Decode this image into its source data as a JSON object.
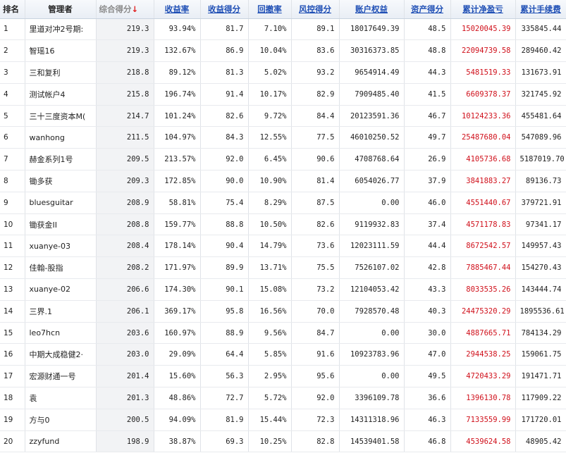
{
  "headers": {
    "rank": "排名",
    "manager": "管理者",
    "composite_score": "综合得分",
    "sort_arrow": "↓",
    "return_rate": "收益率",
    "return_score": "收益得分",
    "drawdown": "回撤率",
    "risk_score": "风控得分",
    "account_equity": "账户权益",
    "asset_score": "资产得分",
    "cum_pnl": "累计净盈亏",
    "cum_fee": "累计手续费"
  },
  "colors": {
    "link": "#1f4fb5",
    "pnl_red": "#d0101b",
    "sort_arrow": "#e02020"
  },
  "rows": [
    {
      "rank": "1",
      "name": "里道对冲2号期:",
      "score": "219.3",
      "ret": "93.94%",
      "ret_score": "81.7",
      "dd": "7.10%",
      "risk": "89.1",
      "equity": "18017649.39",
      "asset": "48.5",
      "pnl": "15020045.39",
      "fee": "335845.44"
    },
    {
      "rank": "2",
      "name": "智瑶16",
      "score": "219.3",
      "ret": "132.67%",
      "ret_score": "86.9",
      "dd": "10.04%",
      "risk": "83.6",
      "equity": "30316373.85",
      "asset": "48.8",
      "pnl": "22094739.58",
      "fee": "289460.42"
    },
    {
      "rank": "3",
      "name": "三和复利",
      "score": "218.8",
      "ret": "89.12%",
      "ret_score": "81.3",
      "dd": "5.02%",
      "risk": "93.2",
      "equity": "9654914.49",
      "asset": "44.3",
      "pnl": "5481519.33",
      "fee": "131673.91"
    },
    {
      "rank": "4",
      "name": "测试帐户4",
      "score": "215.8",
      "ret": "196.74%",
      "ret_score": "91.4",
      "dd": "10.17%",
      "risk": "82.9",
      "equity": "7909485.40",
      "asset": "41.5",
      "pnl": "6609378.37",
      "fee": "321745.92"
    },
    {
      "rank": "5",
      "name": "三十三度资本M(",
      "score": "214.7",
      "ret": "101.24%",
      "ret_score": "82.6",
      "dd": "9.72%",
      "risk": "84.4",
      "equity": "20123591.36",
      "asset": "46.7",
      "pnl": "10124233.36",
      "fee": "455481.64"
    },
    {
      "rank": "6",
      "name": "wanhong",
      "score": "211.5",
      "ret": "104.97%",
      "ret_score": "84.3",
      "dd": "12.55%",
      "risk": "77.5",
      "equity": "46010250.52",
      "asset": "49.7",
      "pnl": "25487680.04",
      "fee": "547089.96"
    },
    {
      "rank": "7",
      "name": "赫金系列1号",
      "score": "209.5",
      "ret": "213.57%",
      "ret_score": "92.0",
      "dd": "6.45%",
      "risk": "90.6",
      "equity": "4708768.64",
      "asset": "26.9",
      "pnl": "4105736.68",
      "fee": "5187019.70"
    },
    {
      "rank": "8",
      "name": "锄多获",
      "score": "209.3",
      "ret": "172.85%",
      "ret_score": "90.0",
      "dd": "10.90%",
      "risk": "81.4",
      "equity": "6054026.77",
      "asset": "37.9",
      "pnl": "3841883.27",
      "fee": "89136.73"
    },
    {
      "rank": "9",
      "name": "bluesguitar",
      "score": "208.9",
      "ret": "58.81%",
      "ret_score": "75.4",
      "dd": "8.29%",
      "risk": "87.5",
      "equity": "0.00",
      "asset": "46.0",
      "pnl": "4551440.67",
      "fee": "379721.91"
    },
    {
      "rank": "10",
      "name": "锄获金II",
      "score": "208.8",
      "ret": "159.77%",
      "ret_score": "88.8",
      "dd": "10.50%",
      "risk": "82.6",
      "equity": "9119932.83",
      "asset": "37.4",
      "pnl": "4571178.83",
      "fee": "97341.17"
    },
    {
      "rank": "11",
      "name": "xuanye-03",
      "score": "208.4",
      "ret": "178.14%",
      "ret_score": "90.4",
      "dd": "14.79%",
      "risk": "73.6",
      "equity": "12023111.59",
      "asset": "44.4",
      "pnl": "8672542.57",
      "fee": "149957.43"
    },
    {
      "rank": "12",
      "name": "佳翰-股指",
      "score": "208.2",
      "ret": "171.97%",
      "ret_score": "89.9",
      "dd": "13.71%",
      "risk": "75.5",
      "equity": "7526107.02",
      "asset": "42.8",
      "pnl": "7885467.44",
      "fee": "154270.43"
    },
    {
      "rank": "13",
      "name": "xuanye-02",
      "score": "206.6",
      "ret": "174.30%",
      "ret_score": "90.1",
      "dd": "15.08%",
      "risk": "73.2",
      "equity": "12104053.42",
      "asset": "43.3",
      "pnl": "8033535.26",
      "fee": "143444.74"
    },
    {
      "rank": "14",
      "name": "三界.1",
      "score": "206.1",
      "ret": "369.17%",
      "ret_score": "95.8",
      "dd": "16.56%",
      "risk": "70.0",
      "equity": "7928570.48",
      "asset": "40.3",
      "pnl": "24475320.29",
      "fee": "1895536.61"
    },
    {
      "rank": "15",
      "name": "leo7hcn",
      "score": "203.6",
      "ret": "160.97%",
      "ret_score": "88.9",
      "dd": "9.56%",
      "risk": "84.7",
      "equity": "0.00",
      "asset": "30.0",
      "pnl": "4887665.71",
      "fee": "784134.29"
    },
    {
      "rank": "16",
      "name": "中期大成稳健2·",
      "score": "203.0",
      "ret": "29.09%",
      "ret_score": "64.4",
      "dd": "5.85%",
      "risk": "91.6",
      "equity": "10923783.96",
      "asset": "47.0",
      "pnl": "2944538.25",
      "fee": "159061.75"
    },
    {
      "rank": "17",
      "name": "宏源财通一号",
      "score": "201.4",
      "ret": "15.60%",
      "ret_score": "56.3",
      "dd": "2.95%",
      "risk": "95.6",
      "equity": "0.00",
      "asset": "49.5",
      "pnl": "4720433.29",
      "fee": "191471.71"
    },
    {
      "rank": "18",
      "name": "袁",
      "score": "201.3",
      "ret": "48.86%",
      "ret_score": "72.7",
      "dd": "5.72%",
      "risk": "92.0",
      "equity": "3396109.78",
      "asset": "36.6",
      "pnl": "1396130.78",
      "fee": "117909.22"
    },
    {
      "rank": "19",
      "name": "方与0",
      "score": "200.5",
      "ret": "94.09%",
      "ret_score": "81.9",
      "dd": "15.44%",
      "risk": "72.3",
      "equity": "14311318.96",
      "asset": "46.3",
      "pnl": "7133559.99",
      "fee": "171720.01"
    },
    {
      "rank": "20",
      "name": "zzyfund",
      "score": "198.9",
      "ret": "38.87%",
      "ret_score": "69.3",
      "dd": "10.25%",
      "risk": "82.8",
      "equity": "14539401.58",
      "asset": "46.8",
      "pnl": "4539624.58",
      "fee": "48905.42"
    }
  ]
}
